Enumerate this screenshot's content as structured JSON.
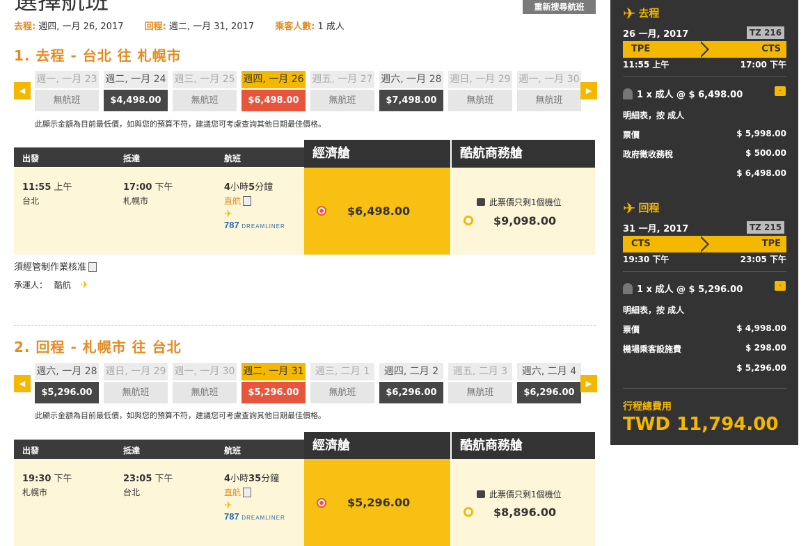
{
  "page_title": "選擇航班",
  "reset_button": "重新搜尋航班",
  "summary": {
    "outbound_label": "去程:",
    "outbound_value": "週四, 一月 26, 2017",
    "return_label": "回程:",
    "return_value": "週二, 一月 31, 2017",
    "pax_label": "乘客人數:",
    "pax_value": "1 成人"
  },
  "outbound": {
    "title": "1. 去程 - 台北 往 札幌市",
    "dates": [
      {
        "day": "週一, 一月 23",
        "price": "無航班",
        "state": "dim"
      },
      {
        "day": "週二, 一月 24",
        "price": "$4,498.00",
        "state": "dark"
      },
      {
        "day": "週三, 一月 25",
        "price": "無航班",
        "state": "dim"
      },
      {
        "day": "週四, 一月 26",
        "price": "$6,498.00",
        "state": "sel"
      },
      {
        "day": "週五, 一月 27",
        "price": "無航班",
        "state": "dim"
      },
      {
        "day": "週六, 一月 28",
        "price": "$7,498.00",
        "state": "dark"
      },
      {
        "day": "週日, 一月 29",
        "price": "無航班",
        "state": "dim"
      },
      {
        "day": "週一, 一月 30",
        "price": "無航班",
        "state": "dim"
      }
    ],
    "note": "此顯示金額為目前最低價，如與您的預算不符，建議您可考慮查詢其他日期最佳價格。",
    "col_depart": "出發",
    "col_arrive": "抵達",
    "col_flight": "航班",
    "cabin_eco": "經濟艙",
    "cabin_biz": "酷航商務艙",
    "dep_time": "11:55",
    "dep_ampm": "上午",
    "dep_city": "台北",
    "arr_time": "17:00",
    "arr_ampm": "下午",
    "arr_city": "札幌市",
    "duration_h": "4",
    "duration_m": "5",
    "duration_text": "小時",
    "duration_min_text": "分鐘",
    "direct": "直航",
    "aircraft_num": "787",
    "aircraft_name": "DREAMLINER",
    "eco_price": "$6,498.00",
    "biz_seat_note": "此票價只剩1個機位",
    "biz_price": "$9,098.00",
    "gov_note": "須經管制作業核准",
    "carrier_label": "承運人：",
    "carrier_value": "酷航"
  },
  "inbound": {
    "title": "2. 回程 - 札幌市 往 台北",
    "dates": [
      {
        "day": "週六, 一月 28",
        "price": "$5,296.00",
        "state": "dark"
      },
      {
        "day": "週日, 一月 29",
        "price": "無航班",
        "state": "dim"
      },
      {
        "day": "週一, 一月 30",
        "price": "無航班",
        "state": "dim"
      },
      {
        "day": "週二, 一月 31",
        "price": "$5,296.00",
        "state": "sel"
      },
      {
        "day": "週三, 二月 1",
        "price": "無航班",
        "state": "dim"
      },
      {
        "day": "週四, 二月 2",
        "price": "$6,296.00",
        "state": "dark"
      },
      {
        "day": "週五, 二月 3",
        "price": "無航班",
        "state": "dim"
      },
      {
        "day": "週六, 二月 4",
        "price": "$6,296.00",
        "state": "dark"
      }
    ],
    "note": "此顯示金額為目前最低價，如與您的預算不符，建議您可考慮查詢其他日期最佳價格。",
    "col_depart": "出發",
    "col_arrive": "抵達",
    "col_flight": "航班",
    "cabin_eco": "經濟艙",
    "cabin_biz": "酷航商務艙",
    "dep_time": "19:30",
    "dep_ampm": "下午",
    "dep_city": "札幌市",
    "arr_time": "23:05",
    "arr_ampm": "下午",
    "arr_city": "台北",
    "duration_h": "4",
    "duration_m": "35",
    "duration_text": "小時",
    "duration_min_text": "分鐘",
    "direct": "直航",
    "aircraft_num": "787",
    "aircraft_name": "DREAMLINER",
    "eco_price": "$5,296.00",
    "biz_seat_note": "此票價只剩1個機位",
    "biz_price": "$8,896.00"
  },
  "sidebar": {
    "out": {
      "heading": "去程",
      "date": "26 一月, 2017",
      "flight_no": "TZ 216",
      "from": "TPE",
      "to": "CTS",
      "dep": "11:55 上午",
      "arr": "17:00 下午",
      "pax": "1 x 成人 @ $ 6,498.00",
      "breakdown_title": "明細表，按 成人",
      "fare_label": "票價",
      "fare_value": "$ 5,998.00",
      "tax_label": "政府徵收務稅",
      "tax_value": "$ 500.00",
      "subtotal": "$ 6,498.00"
    },
    "ret": {
      "heading": "回程",
      "date": "31 一月, 2017",
      "flight_no": "TZ 215",
      "from": "CTS",
      "to": "TPE",
      "dep": "19:30 下午",
      "arr": "23:05 下午",
      "pax": "1 x 成人 @ $ 5,296.00",
      "breakdown_title": "明細表，按 成人",
      "fare_label": "票價",
      "fare_value": "$ 4,998.00",
      "tax_label": "機場乘客設施費",
      "tax_value": "$ 298.00",
      "subtotal": "$ 5,296.00"
    },
    "total_label": "行程總費用",
    "total_value": "TWD 11,794.00"
  },
  "colors": {
    "accent": "#f5b800",
    "title_orange": "#e58a1f",
    "selected_red": "#e7553d",
    "dark": "#333333"
  }
}
